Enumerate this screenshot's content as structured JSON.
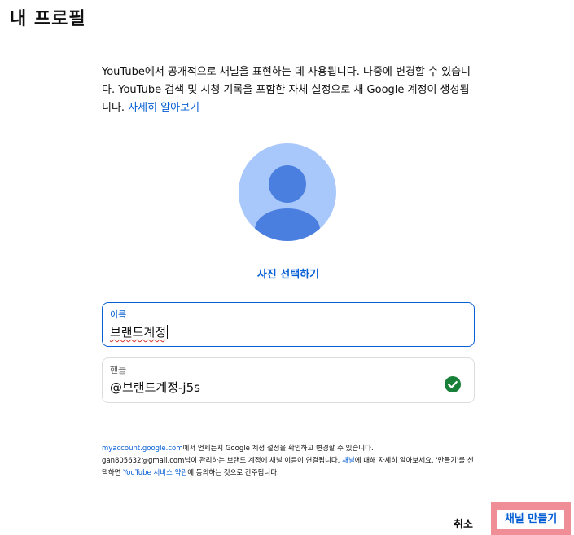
{
  "page": {
    "title": "내 프로필"
  },
  "intro": {
    "text": "YouTube에서 공개적으로 채널을 표현하는 데 사용됩니다. 나중에 변경할 수 있습니다. YouTube 검색 및 시청 기록을 포함한 자체 설정으로 새 Google 계정이 생성됩니다. ",
    "learn_more": "자세히 알아보기"
  },
  "avatar": {
    "icon": "person-avatar-icon",
    "choose_photo": "사진 선택하기",
    "bg_color": "#a8c7fa",
    "fg_color": "#4a7fe0"
  },
  "form": {
    "name": {
      "label": "이름",
      "value": "브랜드계정"
    },
    "handle": {
      "label": "핸들",
      "value": "@브랜드계정-j5s",
      "status_icon": "check-circle-icon",
      "status_color": "#188038"
    }
  },
  "footnote": {
    "line1_link": "myaccount.google.com",
    "line1_text": "에서 언제든지 Google 계정 설정을 확인하고 변경할 수 있습니다.",
    "line2_text_a": "gan805632@gmail.com님이 관리하는 브랜드 계정에 채널 이름이 연결됩니다. ",
    "line2_link": "채널",
    "line2_text_b": "에 대해 자세히 알아보세요. '만들기'를 선택하면 ",
    "line3_link": "YouTube 서비스 약관",
    "line3_text": "에 동의하는 것으로 간주됩니다."
  },
  "actions": {
    "cancel": "취소",
    "create": "채널 만들기",
    "accent_color": "#065fd4",
    "highlight_color": "#f08e98"
  }
}
